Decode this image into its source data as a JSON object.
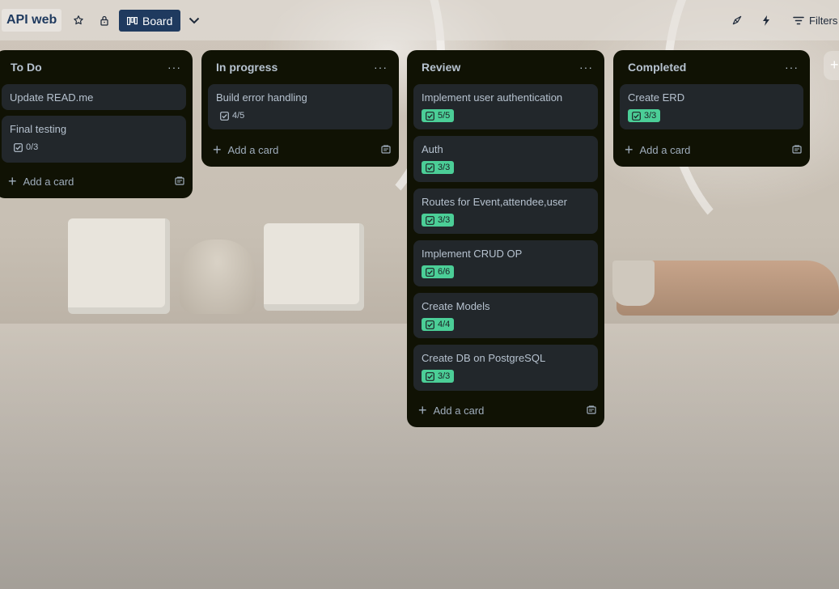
{
  "header": {
    "board_title": "API web",
    "view_label": "Board",
    "filters_label": "Filters"
  },
  "lists": [
    {
      "title": "To Do",
      "cards": [
        {
          "title": "Update READ.me"
        },
        {
          "title": "Final testing",
          "checklist": "0/3",
          "complete": false
        }
      ],
      "add_label": "Add a card"
    },
    {
      "title": "In progress",
      "cards": [
        {
          "title": "Build error handling",
          "checklist": "4/5",
          "complete": false
        }
      ],
      "add_label": "Add a card"
    },
    {
      "title": "Review",
      "cards": [
        {
          "title": "Implement user authentication",
          "checklist": "5/5",
          "complete": true
        },
        {
          "title": "Auth",
          "checklist": "3/3",
          "complete": true
        },
        {
          "title": "Routes for Event,attendee,user",
          "checklist": "3/3",
          "complete": true
        },
        {
          "title": "Implement CRUD OP",
          "checklist": "6/6",
          "complete": true
        },
        {
          "title": "Create Models",
          "checklist": "4/4",
          "complete": true
        },
        {
          "title": "Create DB on PostgreSQL",
          "checklist": "3/3",
          "complete": true
        }
      ],
      "add_label": "Add a card"
    },
    {
      "title": "Completed",
      "cards": [
        {
          "title": "Create ERD",
          "checklist": "3/3",
          "complete": true
        }
      ],
      "add_label": "Add a card"
    }
  ],
  "add_list_symbol": "+",
  "colors": {
    "list_bg": "#101204",
    "card_bg": "#22272b",
    "badge_complete": "#4bce97",
    "header_button": "#1f3a5f"
  },
  "icons": {
    "star": "star-icon",
    "lock": "lock-icon",
    "board": "board-icon",
    "chevron": "chevron-down-icon",
    "rocket": "rocket-icon",
    "automation": "lightning-icon",
    "filter": "filter-icon",
    "checklist": "checklist-icon",
    "template": "card-template-icon",
    "menu": "more-dots-icon",
    "plus": "plus-icon"
  }
}
